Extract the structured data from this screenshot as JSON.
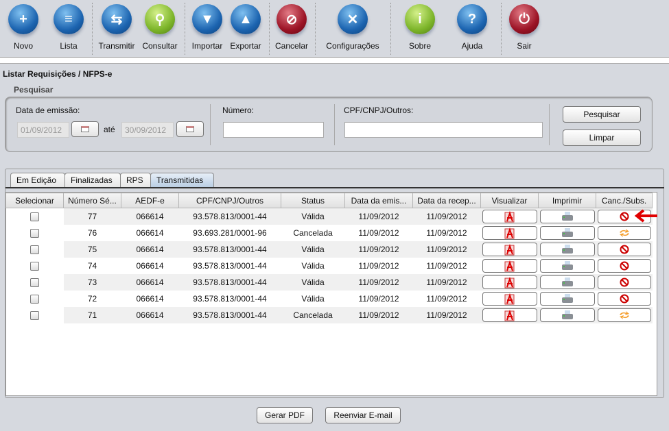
{
  "toolbar": [
    {
      "label": "Novo",
      "icon": "new-document-icon"
    },
    {
      "label": "Lista",
      "icon": "list-icon"
    },
    {
      "label": "Transmitir",
      "icon": "transmit-icon"
    },
    {
      "label": "Consultar",
      "icon": "search-icon"
    },
    {
      "label": "Importar",
      "icon": "import-icon"
    },
    {
      "label": "Exportar",
      "icon": "export-icon"
    },
    {
      "label": "Cancelar",
      "icon": "cancel-icon"
    },
    {
      "label": "Configurações",
      "icon": "settings-icon"
    },
    {
      "label": "Sobre",
      "icon": "info-icon"
    },
    {
      "label": "Ajuda",
      "icon": "help-icon"
    },
    {
      "label": "Sair",
      "icon": "power-icon"
    }
  ],
  "page_title": "Listar Requisições / NFPS-e",
  "search": {
    "legend": "Pesquisar",
    "date_label": "Data de emissão:",
    "date_from": "01/09/2012",
    "ate": "até",
    "date_to": "30/09/2012",
    "numero_label": "Número:",
    "numero": "",
    "cpf_label": "CPF/CNPJ/Outros:",
    "cpf": "",
    "search_button": "Pesquisar",
    "clear_button": "Limpar"
  },
  "tabs": [
    "Em Edição",
    "Finalizadas",
    "RPS",
    "Transmitidas"
  ],
  "active_tab": "Transmitidas",
  "table": {
    "headers": [
      "Selecionar",
      "Número Sé...",
      "AEDF-e",
      "CPF/CNPJ/Outros",
      "Status",
      "Data da emis...",
      "Data da recep...",
      "Visualizar",
      "Imprimir",
      "Canc./Subs."
    ],
    "rows": [
      {
        "numero": "77",
        "aedf": "066614",
        "cpf": "93.578.813/0001-44",
        "status": "Válida",
        "emissao": "11/09/2012",
        "recepcao": "11/09/2012",
        "action": "cancel"
      },
      {
        "numero": "76",
        "aedf": "066614",
        "cpf": "93.693.281/0001-96",
        "status": "Cancelada",
        "emissao": "11/09/2012",
        "recepcao": "11/09/2012",
        "action": "substitute"
      },
      {
        "numero": "75",
        "aedf": "066614",
        "cpf": "93.578.813/0001-44",
        "status": "Válida",
        "emissao": "11/09/2012",
        "recepcao": "11/09/2012",
        "action": "cancel"
      },
      {
        "numero": "74",
        "aedf": "066614",
        "cpf": "93.578.813/0001-44",
        "status": "Válida",
        "emissao": "11/09/2012",
        "recepcao": "11/09/2012",
        "action": "cancel"
      },
      {
        "numero": "73",
        "aedf": "066614",
        "cpf": "93.578.813/0001-44",
        "status": "Válida",
        "emissao": "11/09/2012",
        "recepcao": "11/09/2012",
        "action": "cancel"
      },
      {
        "numero": "72",
        "aedf": "066614",
        "cpf": "93.578.813/0001-44",
        "status": "Válida",
        "emissao": "11/09/2012",
        "recepcao": "11/09/2012",
        "action": "cancel"
      },
      {
        "numero": "71",
        "aedf": "066614",
        "cpf": "93.578.813/0001-44",
        "status": "Cancelada",
        "emissao": "11/09/2012",
        "recepcao": "11/09/2012",
        "action": "substitute"
      }
    ]
  },
  "footer": {
    "pdf_button": "Gerar PDF",
    "email_button": "Reenviar E-mail"
  },
  "colors": {
    "annotation_arrow": "#e00000"
  }
}
